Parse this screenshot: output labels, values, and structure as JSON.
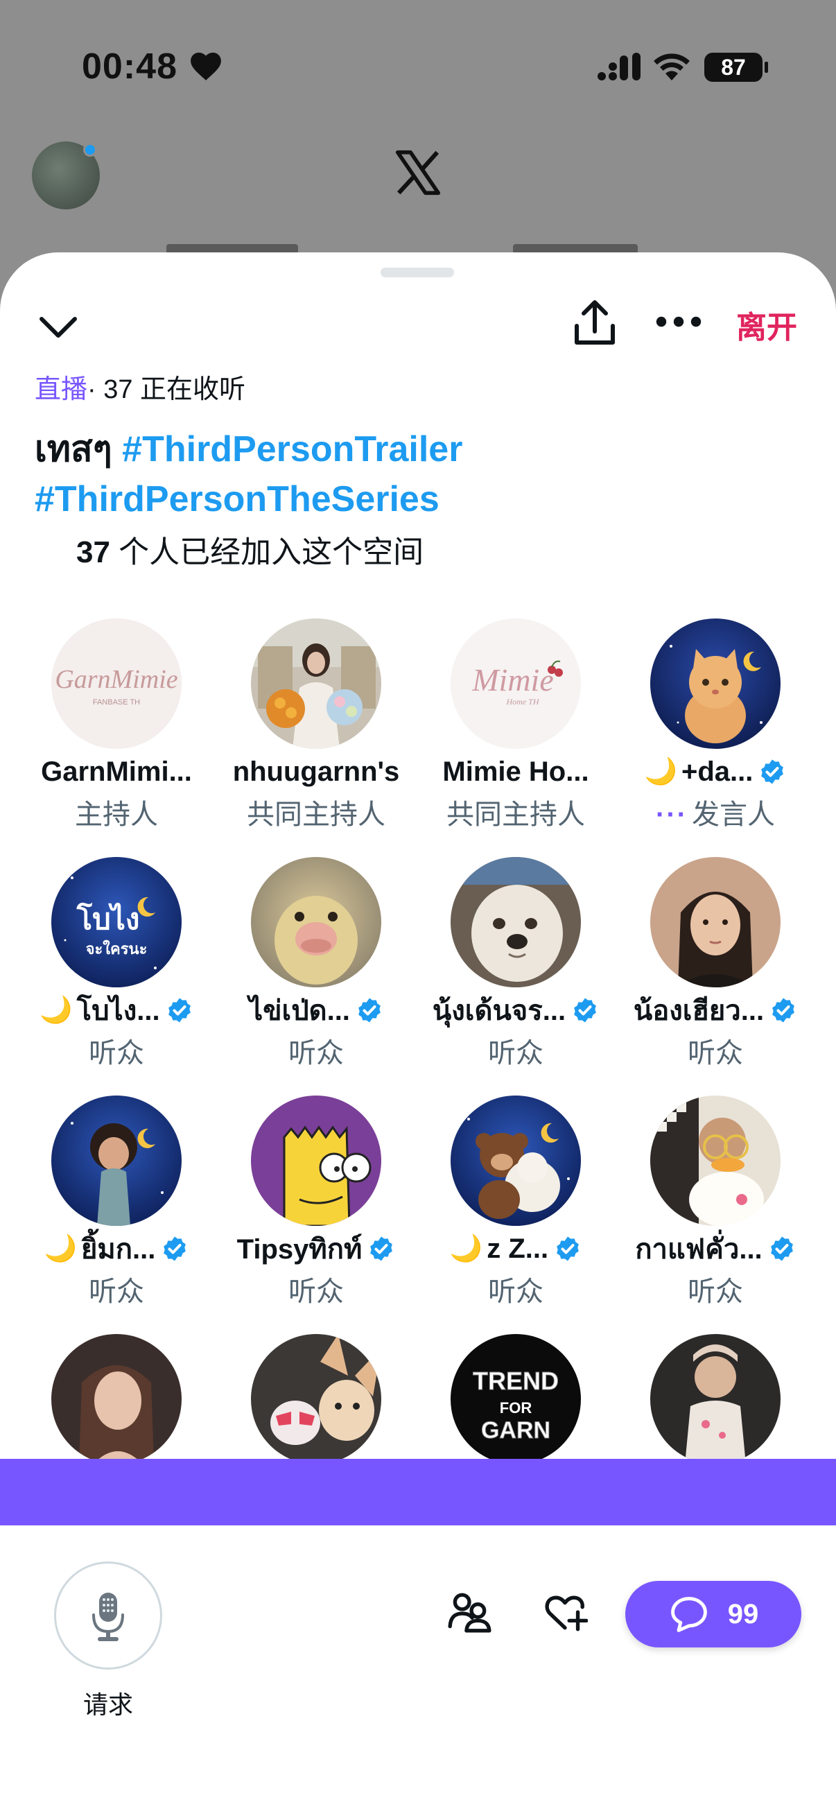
{
  "status_bar": {
    "time": "00:48",
    "battery": "87"
  },
  "colors": {
    "accent_purple": "#7856ff",
    "link_blue": "#1d9bf0",
    "leave_red": "#e0245e",
    "secondary_text": "#536471"
  },
  "header": {
    "leave_label": "离开",
    "icons": [
      "chevron-down-icon",
      "share-icon",
      "more-icon"
    ]
  },
  "space": {
    "live_tag": "直播",
    "listening": "· 37 正在收听",
    "title_prefix": "เทสๆ ",
    "hashtag_1": "#ThirdPersonTrailer",
    "hashtag_2": "#ThirdPersonTheSeries",
    "joined_count": "37",
    "joined_text": " 个人已经加入这个空间"
  },
  "participants": [
    {
      "name": "GarnMimi...",
      "role": "主持人",
      "verified": false,
      "moon": false
    },
    {
      "name": "nhuugarnn's",
      "role": "共同主持人",
      "verified": false,
      "moon": false
    },
    {
      "name": "Mimie Ho...",
      "role": "共同主持人",
      "verified": false,
      "moon": false
    },
    {
      "name": "+da...",
      "role": "发言人",
      "verified": true,
      "moon": true
    },
    {
      "name": "โบไง...",
      "role": "听众",
      "verified": true,
      "moon": true
    },
    {
      "name": "ไข่เป่ด...",
      "role": "听众",
      "verified": true,
      "moon": false
    },
    {
      "name": "นุ้งเด้นจร...",
      "role": "听众",
      "verified": true,
      "moon": false
    },
    {
      "name": "น้องเฮียว...",
      "role": "听众",
      "verified": true,
      "moon": false
    },
    {
      "name": "ยิ้มก...",
      "role": "听众",
      "verified": true,
      "moon": true
    },
    {
      "name": "Tipsyทิกท์",
      "role": "听众",
      "verified": true,
      "moon": false
    },
    {
      "name": "z Z...",
      "role": "听众",
      "verified": true,
      "moon": true
    },
    {
      "name": "กาแฟคั่ว...",
      "role": "听众",
      "verified": true,
      "moon": false
    }
  ],
  "avatar_text": {
    "garnmimi": "GarnMimie",
    "garnmimi_sub": "FANBASE TH",
    "mimie_home": "Mimie",
    "mimie_home_sub": "Home TH",
    "bopai": "โบไง",
    "bopai_sub": "จะใครนะ",
    "trend_1": "TREND",
    "trend_2": "FOR",
    "trend_3": "GARN"
  },
  "footer": {
    "request_label": "请求",
    "chat_count": "99",
    "icons": [
      "microphone-icon",
      "people-icon",
      "heart-plus-icon",
      "chat-bubble-icon"
    ]
  }
}
